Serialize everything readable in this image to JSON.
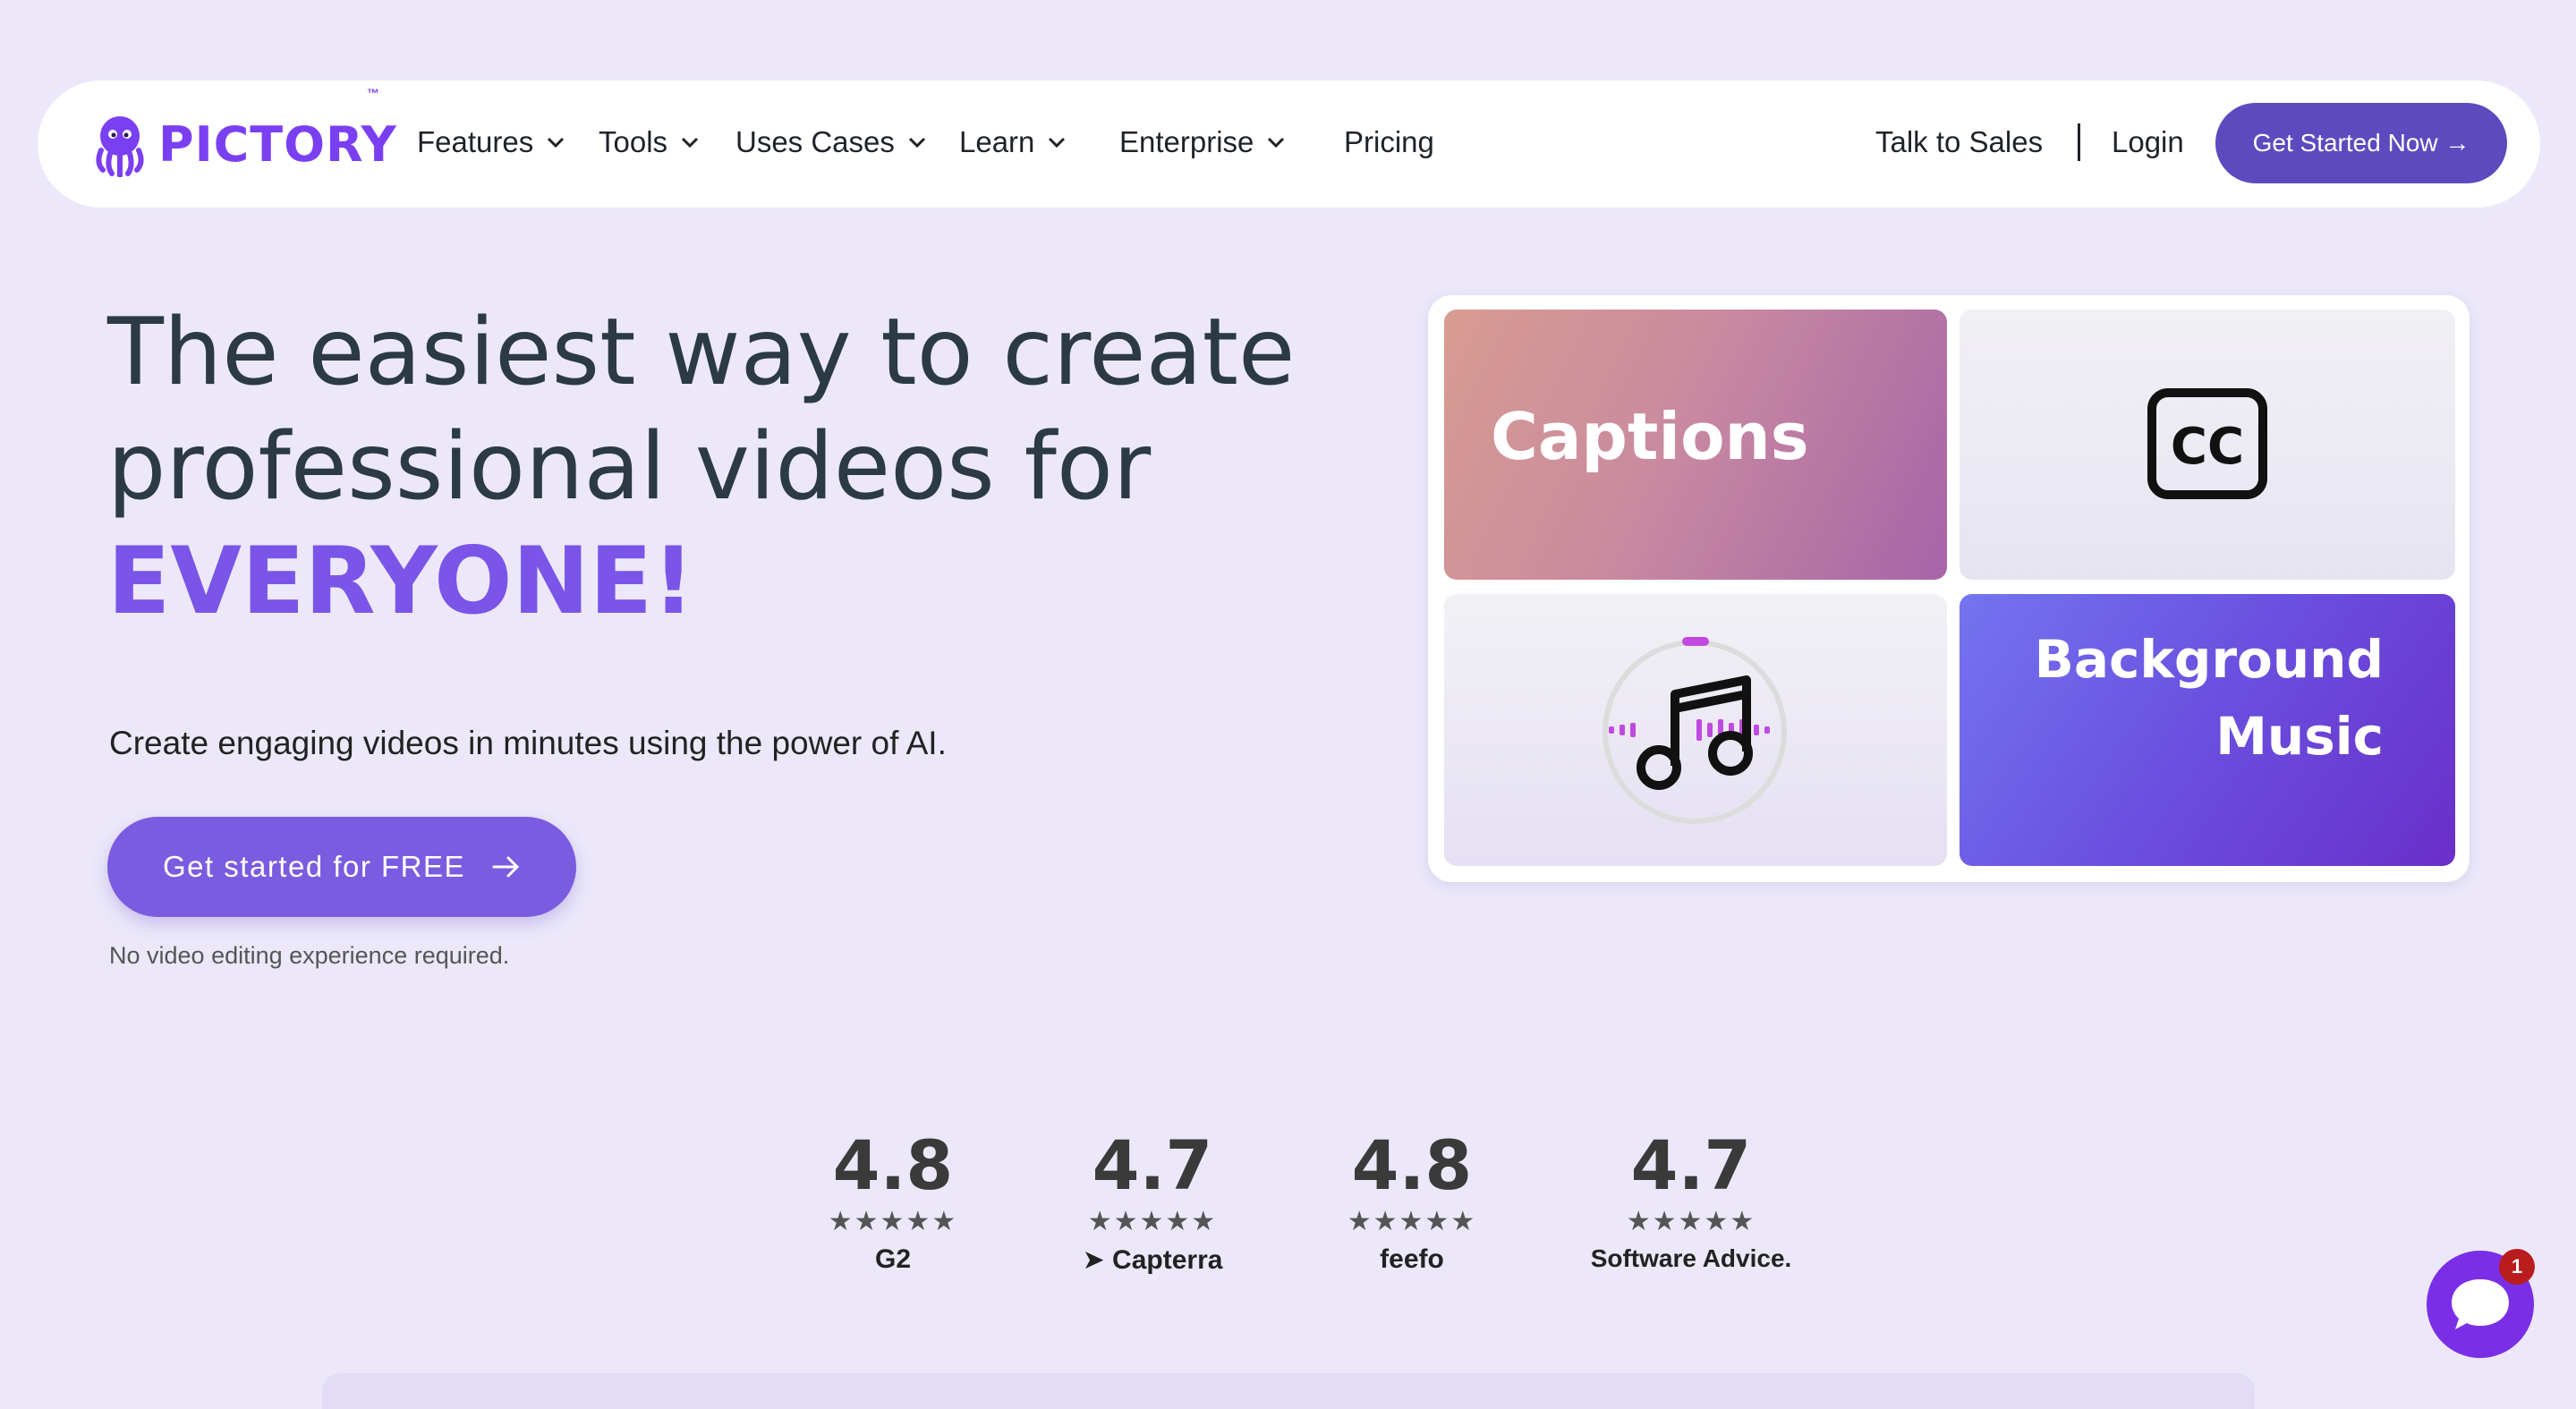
{
  "nav": {
    "logo_text": "PICTORY",
    "logo_tm": "™",
    "items": [
      {
        "label": "Features",
        "dropdown": true
      },
      {
        "label": "Tools",
        "dropdown": true
      },
      {
        "label": "Uses Cases",
        "dropdown": true
      },
      {
        "label": "Learn",
        "dropdown": true
      },
      {
        "label": "Enterprise",
        "dropdown": true
      },
      {
        "label": "Pricing",
        "dropdown": false
      }
    ],
    "talk_to_sales": "Talk to Sales",
    "login": "Login",
    "cta": "Get Started Now →"
  },
  "hero": {
    "headline_line1": "The easiest way to create",
    "headline_line2": "professional videos for",
    "headline_highlight": "EVERYONE!",
    "subtitle": "Create engaging videos in minutes using the power of AI.",
    "cta": "Get started for FREE",
    "note": "No video editing experience required."
  },
  "features": {
    "captions_label": "Captions",
    "cc_icon_text": "CC",
    "music_label_line1": "Background",
    "music_label_line2": "Music"
  },
  "ratings": [
    {
      "score": "4.8",
      "stars": "★★★★★",
      "brand": "G2"
    },
    {
      "score": "4.7",
      "stars": "★★★★★",
      "brand": "Capterra"
    },
    {
      "score": "4.8",
      "stars": "★★★★★",
      "brand": "feefo"
    },
    {
      "score": "4.7",
      "stars": "★★★★★",
      "brand": "Software Advice."
    }
  ],
  "chat": {
    "badge_count": "1"
  },
  "colors": {
    "accent": "#7A55E8",
    "background": "#ECE8FA",
    "nav_cta": "#5E4ABF"
  }
}
